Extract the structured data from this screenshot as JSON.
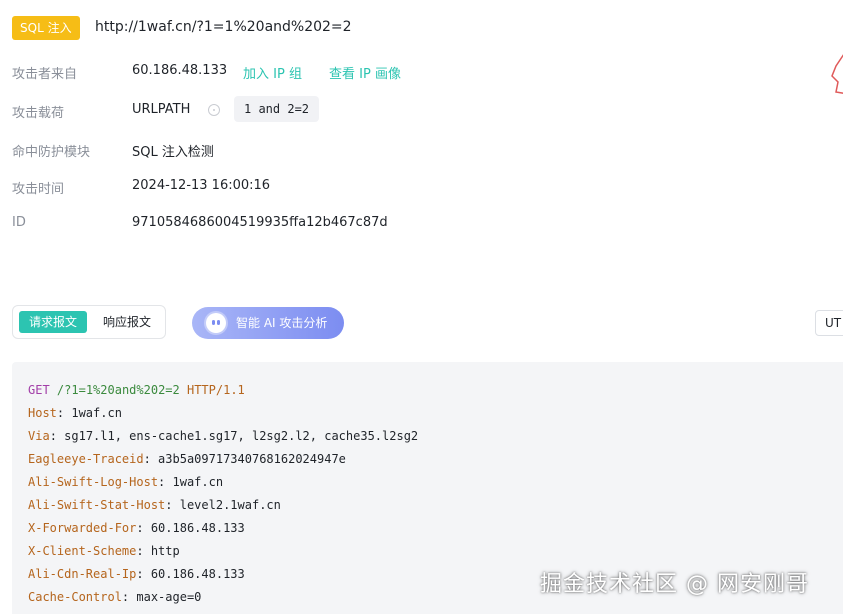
{
  "header": {
    "badge": "SQL 注入",
    "url": "http://1waf.cn/?1=1%20and%202=2"
  },
  "details": {
    "source_label": "攻击者来自",
    "source_ip": "60.186.48.133",
    "add_ip_group": "加入 IP 组",
    "view_ip_profile": "查看 IP 画像",
    "payload_label": "攻击载荷",
    "payload_location": "URLPATH",
    "payload_value": "1 and 2=2",
    "module_label": "命中防护模块",
    "module_value": "SQL 注入检测",
    "time_label": "攻击时间",
    "time_value": "2024-12-13 16:00:16",
    "id_label": "ID",
    "id_value": "9710584686004519935ffa12b467c87d"
  },
  "toolbar": {
    "request_tab": "请求报文",
    "response_tab": "响应报文",
    "ai_button": "智能 AI 攻击分析",
    "encoding": "UT"
  },
  "request": {
    "method": "GET",
    "path": "/?1=1%20and%202=2",
    "protocol": "HTTP/1.1",
    "headers": [
      {
        "key": "Host",
        "value": "1waf.cn"
      },
      {
        "key": "Via",
        "value": "sg17.l1, ens-cache1.sg17, l2sg2.l2, cache35.l2sg2"
      },
      {
        "key": "Eagleeye-Traceid",
        "value": "a3b5a09717340768162024947e"
      },
      {
        "key": "Ali-Swift-Log-Host",
        "value": "1waf.cn"
      },
      {
        "key": "Ali-Swift-Stat-Host",
        "value": "level2.1waf.cn"
      },
      {
        "key": "X-Forwarded-For",
        "value": "60.186.48.133"
      },
      {
        "key": "X-Client-Scheme",
        "value": "http"
      },
      {
        "key": "Ali-Cdn-Real-Ip",
        "value": "60.186.48.133"
      },
      {
        "key": "Cache-Control",
        "value": "max-age=0"
      }
    ]
  },
  "watermark": "掘金技术社区 @ 网安刚哥",
  "colors": {
    "accent": "#2cc4b1",
    "badge": "#f6bd16",
    "ai_gradient_end": "#7c8df1"
  }
}
